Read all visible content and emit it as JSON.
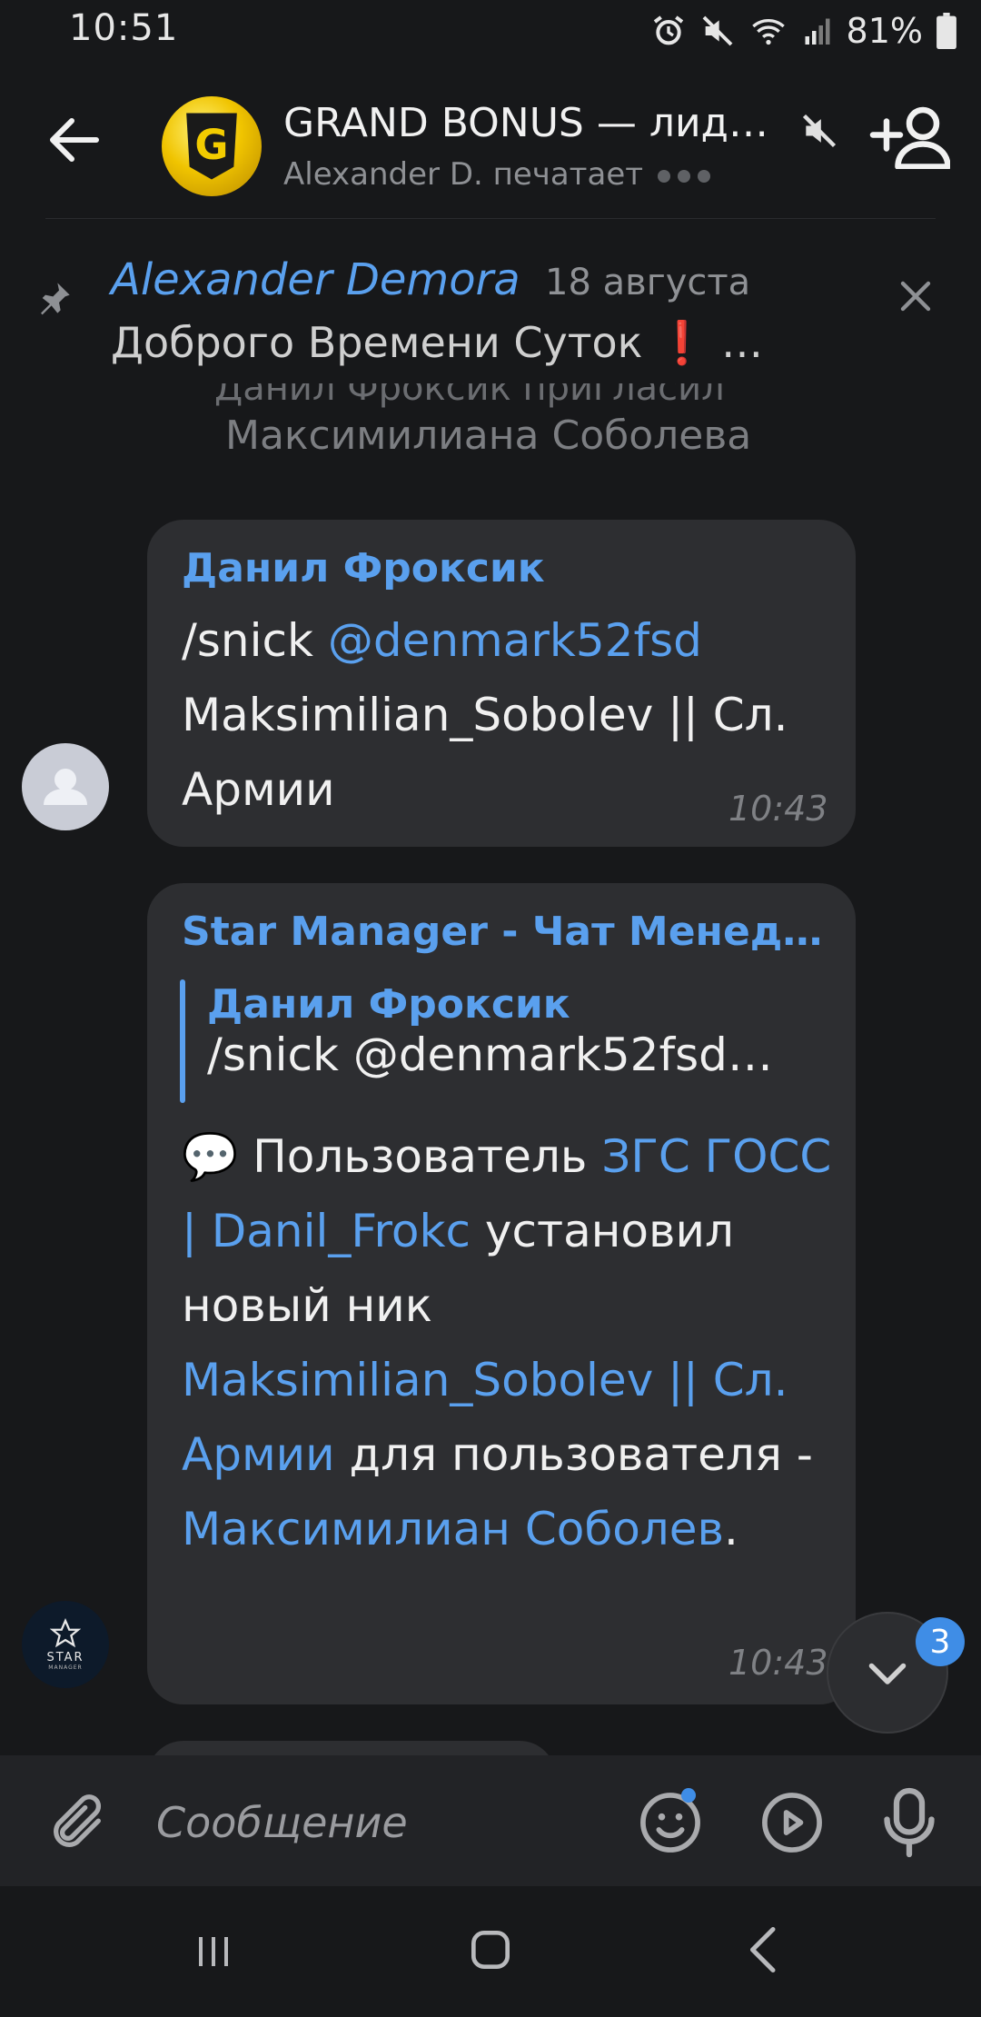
{
  "status_bar": {
    "time": "10:51",
    "battery_percent": "81%",
    "icons": [
      "alarm-icon",
      "mute-icon",
      "wifi-icon",
      "signal-icon",
      "battery-icon"
    ]
  },
  "header": {
    "title": "GRAND BONUS — лидеры…",
    "subtitle": "Alexander D. печатает",
    "avatar_letter": "G",
    "accent": "#5aa0ee"
  },
  "pinned": {
    "author": "Alexander Demora",
    "date": "18 августа",
    "text": "Доброго Времени Суток ❗ …"
  },
  "service_message": {
    "line1": "Данил Фроксик пригласил",
    "line2": "Максимилиана Соболева"
  },
  "messages": [
    {
      "sender": "Данил Фроксик",
      "text_cmd": "/snick ",
      "text_mention": "@denmark52fsd",
      "text_rest": " Maksimilian_Sobolev || Сл. Армии",
      "time": "10:43"
    },
    {
      "sender": "Star Manager - Чат Менед…",
      "avatar_text": "STAR",
      "avatar_subtext": "MANAGER",
      "quote_name": "Данил Фроксик",
      "quote_text": "/snick @denmark52fsd…",
      "emoji": "💬",
      "p1": " Пользователь ",
      "link1": "ЗГС ГОСС | Danil_Frokc",
      "p2": " установил новый ник ",
      "link2": "Maksimilian_Sobolev || Сл. Армии",
      "p3": " для пользователя - ",
      "link3": "Максимилиан Соболев",
      "p4": ".",
      "time": "10:43"
    }
  ],
  "scroll_down": {
    "unread_count": "3"
  },
  "input": {
    "placeholder": "Сообщение"
  }
}
